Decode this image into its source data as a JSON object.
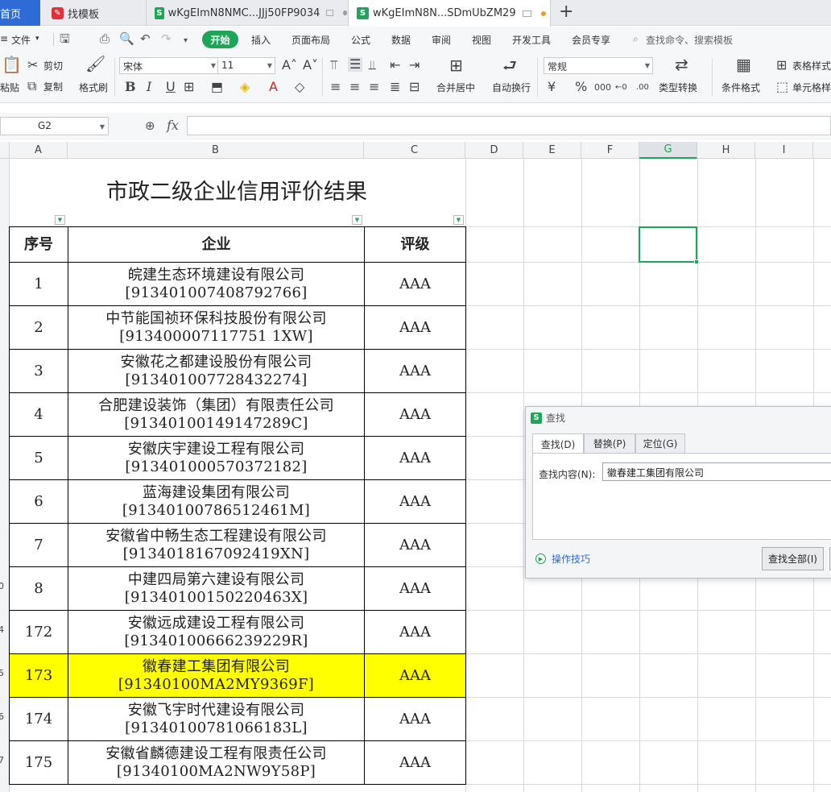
{
  "tabs": {
    "home": "首页",
    "templates": "找模板",
    "doc1": "wKgEImN8NMC...JJj50FP9034",
    "doc2": "wKgEImN8N...SDmUbZM29",
    "new_tab": "+"
  },
  "menu": {
    "file": "文件",
    "start": "开始",
    "insert": "插入",
    "page_layout": "页面布局",
    "formula": "公式",
    "data": "数据",
    "review": "审阅",
    "view": "视图",
    "developer": "开发工具",
    "vip": "会员专享",
    "search": "查找命令、搜索模板"
  },
  "ribbon": {
    "paste": "粘贴",
    "cut": "剪切",
    "copy": "复制",
    "format_painter": "格式刷",
    "font_name": "宋体",
    "font_size": "11",
    "merge_center": "合并居中",
    "wrap_text": "自动换行",
    "number_format": "常规",
    "type_convert": "类型转换",
    "conditional_format": "条件格式",
    "table_style": "表格样式",
    "cell_style": "单元格样式",
    "bold": "B",
    "italic": "I",
    "underline": "U"
  },
  "formula_bar": {
    "cell_ref": "G2",
    "fx": "fx",
    "value": ""
  },
  "sheet": {
    "columns": [
      "A",
      "B",
      "C",
      "D",
      "E",
      "F",
      "G",
      "H",
      "I"
    ],
    "selected_column": "G",
    "row_numbers": [
      "0",
      "4",
      "5",
      "6",
      "7"
    ],
    "title": "市政二级企业信用评价结果",
    "headers": [
      "序号",
      "企业",
      "评级"
    ],
    "rows": [
      {
        "no": "1",
        "name": "皖建生态环境建设有限公司",
        "code": "[913401007408792766]",
        "grade": "AAA"
      },
      {
        "no": "2",
        "name": "中节能国祯环保科技股份有限公司",
        "code": "[913400007117751 1XW]",
        "grade": "AAA"
      },
      {
        "no": "3",
        "name": "安徽花之都建设股份有限公司",
        "code": "[913401007728432274]",
        "grade": "AAA"
      },
      {
        "no": "4",
        "name": "合肥建设装饰（集团）有限责任公司",
        "code": "[91340100149147289C]",
        "grade": "AAA"
      },
      {
        "no": "5",
        "name": "安徽庆宇建设工程有限公司",
        "code": "[913401000570372182]",
        "grade": "AAA"
      },
      {
        "no": "6",
        "name": "蓝海建设集团有限公司",
        "code": "[91340100786512461M]",
        "grade": "AAA"
      },
      {
        "no": "7",
        "name": "安徽省中畅生态工程建设有限公司",
        "code": "[9134018167092419XN]",
        "grade": "AAA"
      },
      {
        "no": "8",
        "name": "中建四局第六建设有限公司",
        "code": "[91340100150220463X]",
        "grade": "AAA"
      },
      {
        "no": "172",
        "name": "安徽远成建设工程有限公司",
        "code": "[91340100666239229R]",
        "grade": "AAA"
      },
      {
        "no": "173",
        "name": "徽春建工集团有限公司",
        "code": "[91340100MA2MY9369F]",
        "grade": "AAA",
        "highlighted": true
      },
      {
        "no": "174",
        "name": "安徽飞宇时代建设有限公司",
        "code": "[91340100781066183L]",
        "grade": "AAA"
      },
      {
        "no": "175",
        "name": "安徽省麟德建设工程有限责任公司",
        "code": "[91340100MA2NW9Y58P]",
        "grade": "AAA"
      }
    ],
    "highlight_color": "#ffff00"
  },
  "find_dialog": {
    "title": "查找",
    "tabs": [
      "查找(D)",
      "替换(P)",
      "定位(G)"
    ],
    "active_tab": "查找(D)",
    "find_label": "查找内容(N):",
    "find_value": "徽春建工集团有限公司",
    "tips": "操作技巧",
    "find_all": "查找全部(I)"
  },
  "colors": {
    "accent_green": "#1fa557",
    "home_tab_blue": "#2f6bd6"
  }
}
